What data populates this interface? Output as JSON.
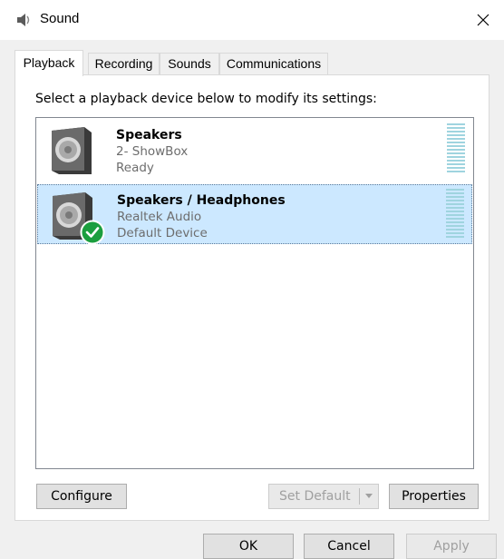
{
  "window": {
    "title": "Sound",
    "icon": "speaker-icon",
    "close_icon": "close-icon"
  },
  "tabs": [
    {
      "label": "Playback",
      "active": true
    },
    {
      "label": "Recording",
      "active": false
    },
    {
      "label": "Sounds",
      "active": false
    },
    {
      "label": "Communications",
      "active": false
    }
  ],
  "instruction": "Select a playback device below to modify its settings:",
  "devices": [
    {
      "name": "Speakers",
      "detail": "2- ShowBox",
      "status": "Ready",
      "selected": false,
      "default": false,
      "icon": "speaker-device-icon"
    },
    {
      "name": "Speakers / Headphones",
      "detail": "Realtek Audio",
      "status": "Default Device",
      "selected": true,
      "default": true,
      "icon": "speaker-device-icon",
      "badge_icon": "default-check-icon"
    }
  ],
  "panel_buttons": {
    "configure": "Configure",
    "set_default": "Set Default",
    "properties": "Properties"
  },
  "dialog_buttons": {
    "ok": "OK",
    "cancel": "Cancel",
    "apply": "Apply"
  },
  "colors": {
    "selection": "#cce8ff",
    "meter": "#9fd4df",
    "check_badge": "#1b9e3e"
  }
}
